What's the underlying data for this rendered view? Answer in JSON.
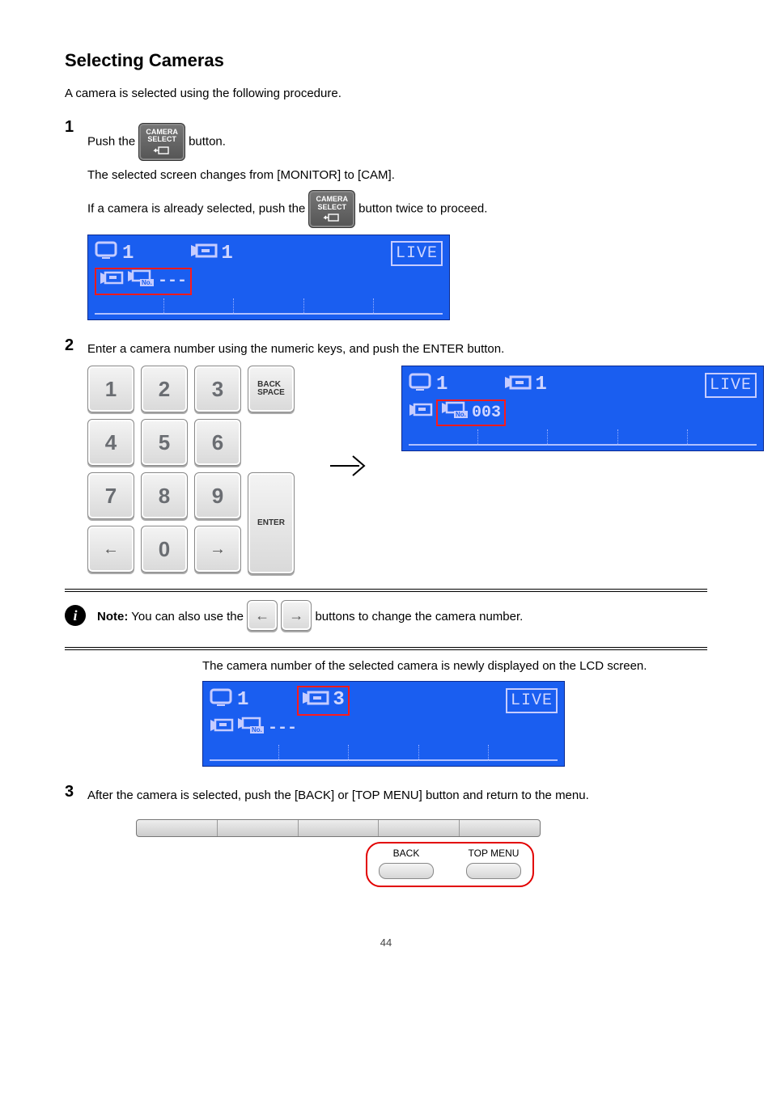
{
  "title": "Selecting Cameras",
  "intro": "A camera is selected using the following procedure.",
  "steps": {
    "s1": {
      "num": "1",
      "text_a": "Push the ",
      "text_b": " button.",
      "after": "The selected screen changes from [MONITOR] to [CAM].",
      "alt_a": "If a camera is already selected, push the ",
      "alt_b": " button twice to proceed."
    },
    "s2": {
      "num": "2",
      "text": "Enter a camera number using the numeric keys, and push the ENTER button.",
      "after": "The camera number of the selected camera is newly displayed on the LCD screen."
    },
    "s3": {
      "num": "3",
      "text": "After the camera is selected, push the [BACK] or [TOP MENU] button and return to the menu."
    }
  },
  "key_label": "CAMERA\nSELECT",
  "lcd": {
    "monitor": "1",
    "cam1": "1",
    "cam3": "3",
    "live": "LIVE",
    "dashes": "---",
    "entered": "003"
  },
  "notes": {
    "hdr": "Note:",
    "n1_a": "You can also use the ",
    "n1_b": " buttons to change the camera number."
  },
  "soft": {
    "back": "BACK",
    "top": "TOP MENU"
  },
  "page_number": "44"
}
